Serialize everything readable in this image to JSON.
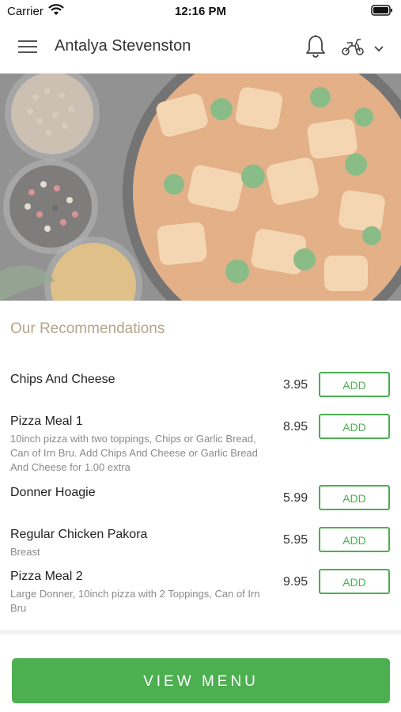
{
  "status_bar": {
    "carrier": "Carrier",
    "time": "12:16 PM"
  },
  "header": {
    "title": "Antalya Stevenston",
    "icons": [
      "menu-icon",
      "bell-icon",
      "scooter-icon",
      "chevron-down-icon"
    ]
  },
  "hero": {
    "alt_icons": [
      "curry-dish",
      "spice-bowls"
    ]
  },
  "recommendations": {
    "title": "Our Recommendations",
    "items": [
      {
        "name": "Chips And Cheese",
        "description": "",
        "price": "3.95",
        "add_label": "ADD"
      },
      {
        "name": "Pizza Meal 1",
        "description": "10inch pizza with two toppings, Chips or Garlic Bread, Can of Irn Bru. Add Chips And Cheese or Garlic Bread And Cheese for 1.00 extra",
        "price": "8.95",
        "add_label": "ADD"
      },
      {
        "name": "Donner Hoagie",
        "description": "",
        "price": "5.99",
        "add_label": "ADD"
      },
      {
        "name": "Regular Chicken Pakora",
        "description": "Breast",
        "price": "5.95",
        "add_label": "ADD"
      },
      {
        "name": "Pizza Meal 2",
        "description": "Large Donner, 10inch pizza with 2 Toppings, Can of Irn Bru",
        "price": "9.95",
        "add_label": "ADD"
      }
    ]
  },
  "view_menu_label": "VIEW MENU",
  "colors": {
    "accent_green": "#4caf50",
    "section_title": "#b5a48a"
  }
}
